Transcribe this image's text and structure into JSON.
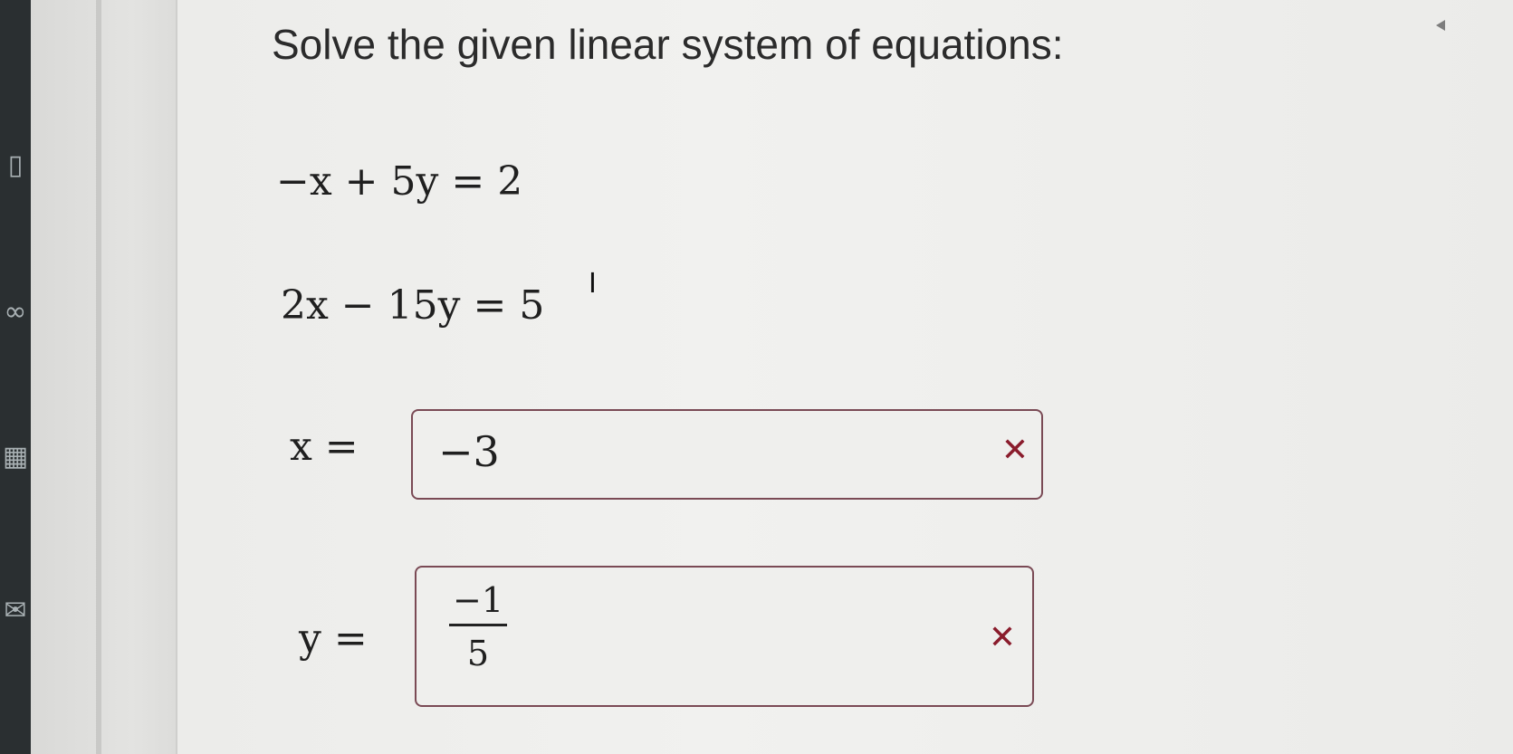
{
  "question": {
    "title": "Solve the given linear system of equations:"
  },
  "equations": {
    "eq1": "−x + 5y = 2",
    "eq2": "2x − 15y = 5"
  },
  "answers": {
    "x": {
      "label": "x =",
      "value": "−3",
      "status_icon": "close-icon",
      "status": "incorrect"
    },
    "y": {
      "label": "y =",
      "numerator": "−1",
      "denominator": "5",
      "status_icon": "close-icon",
      "status": "incorrect"
    }
  },
  "colors": {
    "incorrect_mark": "#8a1c2c",
    "answer_border": "#7a4a55"
  },
  "icons": {
    "wrong": "✕",
    "text_cursor": "I"
  }
}
